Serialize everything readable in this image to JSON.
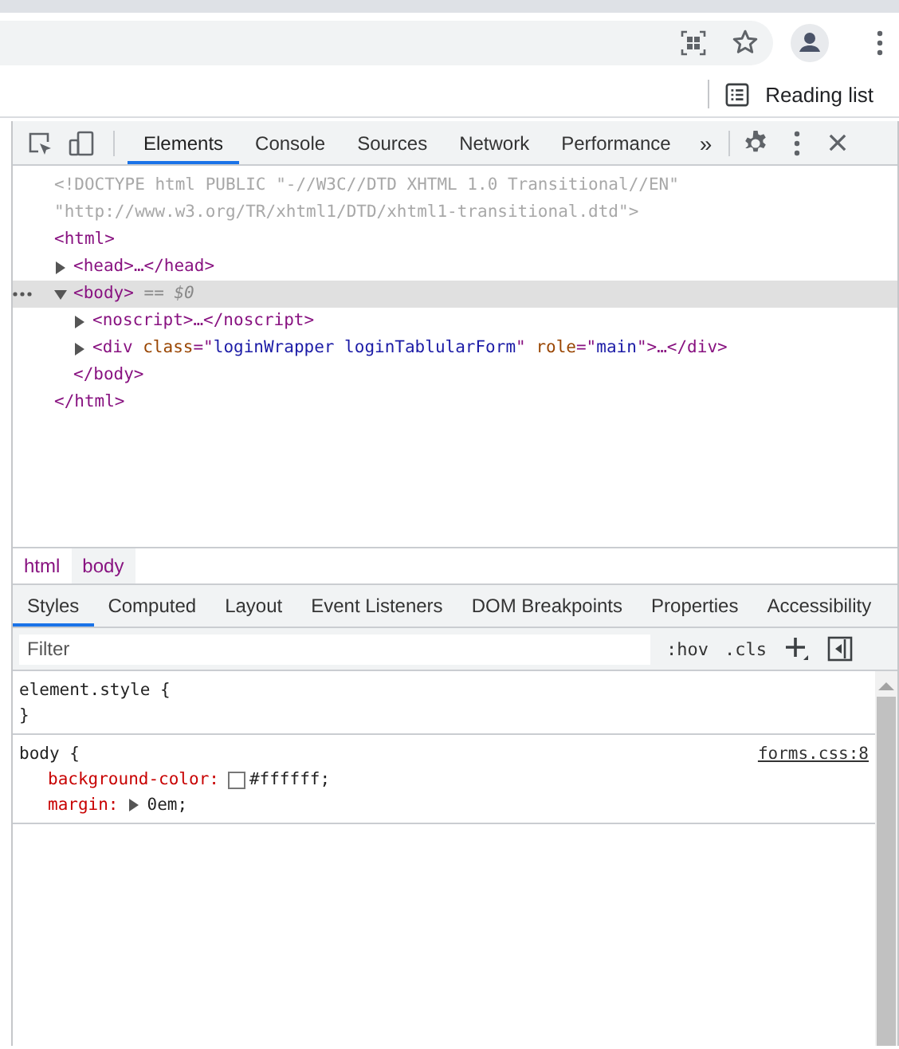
{
  "bookmarks_bar": {
    "reading_list": "Reading list"
  },
  "devtools": {
    "tabs": [
      {
        "label": "Elements",
        "selected": true
      },
      {
        "label": "Console",
        "selected": false
      },
      {
        "label": "Sources",
        "selected": false
      },
      {
        "label": "Network",
        "selected": false
      },
      {
        "label": "Performance",
        "selected": false
      }
    ],
    "more_tabs": "»",
    "dom_tree": [
      {
        "tokens": [
          {
            "kind": "doctype",
            "text": "<!DOCTYPE html PUBLIC \"-//W3C//DTD XHTML 1.0 Transitional//EN\" \"http://www.w3.org/TR/xhtml1/DTD/xhtml1-transitional.dtd\">"
          }
        ],
        "selected": false
      },
      {
        "tokens": [
          {
            "kind": "tag",
            "text": "<html>"
          }
        ],
        "selected": false,
        "closing": "</html>",
        "children": [
          {
            "tokens": [
              {
                "kind": "tag",
                "text": "<head>"
              },
              {
                "kind": "tag",
                "text": "…</head>"
              }
            ],
            "expanded": false,
            "selected": false
          },
          {
            "tokens": [
              {
                "kind": "tag",
                "text": "<body>"
              },
              {
                "kind": "ref",
                "text": " == $0"
              }
            ],
            "expanded": true,
            "selected": true,
            "closing": "</body>",
            "children": [
              {
                "tokens": [
                  {
                    "kind": "tag",
                    "text": "<noscript>"
                  },
                  {
                    "kind": "tag",
                    "text": "…</noscript>"
                  }
                ],
                "expanded": false,
                "selected": false
              },
              {
                "tokens": [
                  {
                    "kind": "tag",
                    "text": "<div "
                  },
                  {
                    "kind": "attr",
                    "text": "class"
                  },
                  {
                    "kind": "tag",
                    "text": "=\""
                  },
                  {
                    "kind": "value",
                    "text": "loginWrapper loginTablularForm"
                  },
                  {
                    "kind": "tag",
                    "text": "\" "
                  },
                  {
                    "kind": "attr",
                    "text": "role"
                  },
                  {
                    "kind": "tag",
                    "text": "=\""
                  },
                  {
                    "kind": "value",
                    "text": "main"
                  },
                  {
                    "kind": "tag",
                    "text": "\">…</div>"
                  }
                ],
                "expanded": false,
                "selected": false
              }
            ]
          }
        ]
      }
    ],
    "breadcrumbs": [
      {
        "label": "html",
        "selected": false
      },
      {
        "label": "body",
        "selected": true
      }
    ],
    "sidebar_tabs": [
      {
        "label": "Styles",
        "selected": true
      },
      {
        "label": "Computed",
        "selected": false
      },
      {
        "label": "Layout",
        "selected": false
      },
      {
        "label": "Event Listeners",
        "selected": false
      },
      {
        "label": "DOM Breakpoints",
        "selected": false
      },
      {
        "label": "Properties",
        "selected": false
      },
      {
        "label": "Accessibility",
        "selected": false
      }
    ],
    "filter": {
      "placeholder": "Filter"
    },
    "filter_buttons": [
      ":hov",
      ".cls"
    ],
    "rules": [
      {
        "selector": "element.style {",
        "end": "}"
      },
      {
        "selector": "body {",
        "source": "forms.css:8",
        "declarations": [
          {
            "kind": "color",
            "property": "background-color:",
            "value": "#ffffff;",
            "color": "#ffffff"
          },
          {
            "kind": "shorthand",
            "property": "margin:",
            "value": "0em;"
          }
        ]
      }
    ]
  }
}
